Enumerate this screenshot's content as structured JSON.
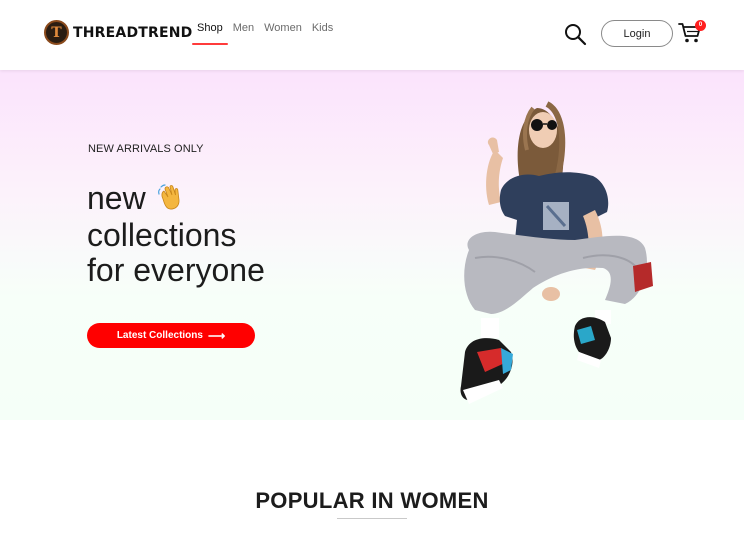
{
  "brand": {
    "logo_letter": "T",
    "name": "THREADTREND"
  },
  "nav": {
    "items": [
      {
        "label": "Shop",
        "active": true
      },
      {
        "label": "Men",
        "active": false
      },
      {
        "label": "Women",
        "active": false
      },
      {
        "label": "Kids",
        "active": false
      }
    ],
    "active_color": "#ff3b3b",
    "search_icon": "search-icon",
    "login_label": "Login",
    "cart_icon": "cart-icon",
    "cart_count": "0"
  },
  "hero": {
    "eyebrow": "NEW ARRIVALS ONLY",
    "headline_lines": [
      "new",
      "collections",
      "for everyone"
    ],
    "hand_icon": "waving-hand-icon",
    "cta_label": "Latest Collections",
    "cta_icon": "arrow-right-icon",
    "cta_color": "#ff0000"
  },
  "popular": {
    "title": "POPULAR IN WOMEN"
  }
}
